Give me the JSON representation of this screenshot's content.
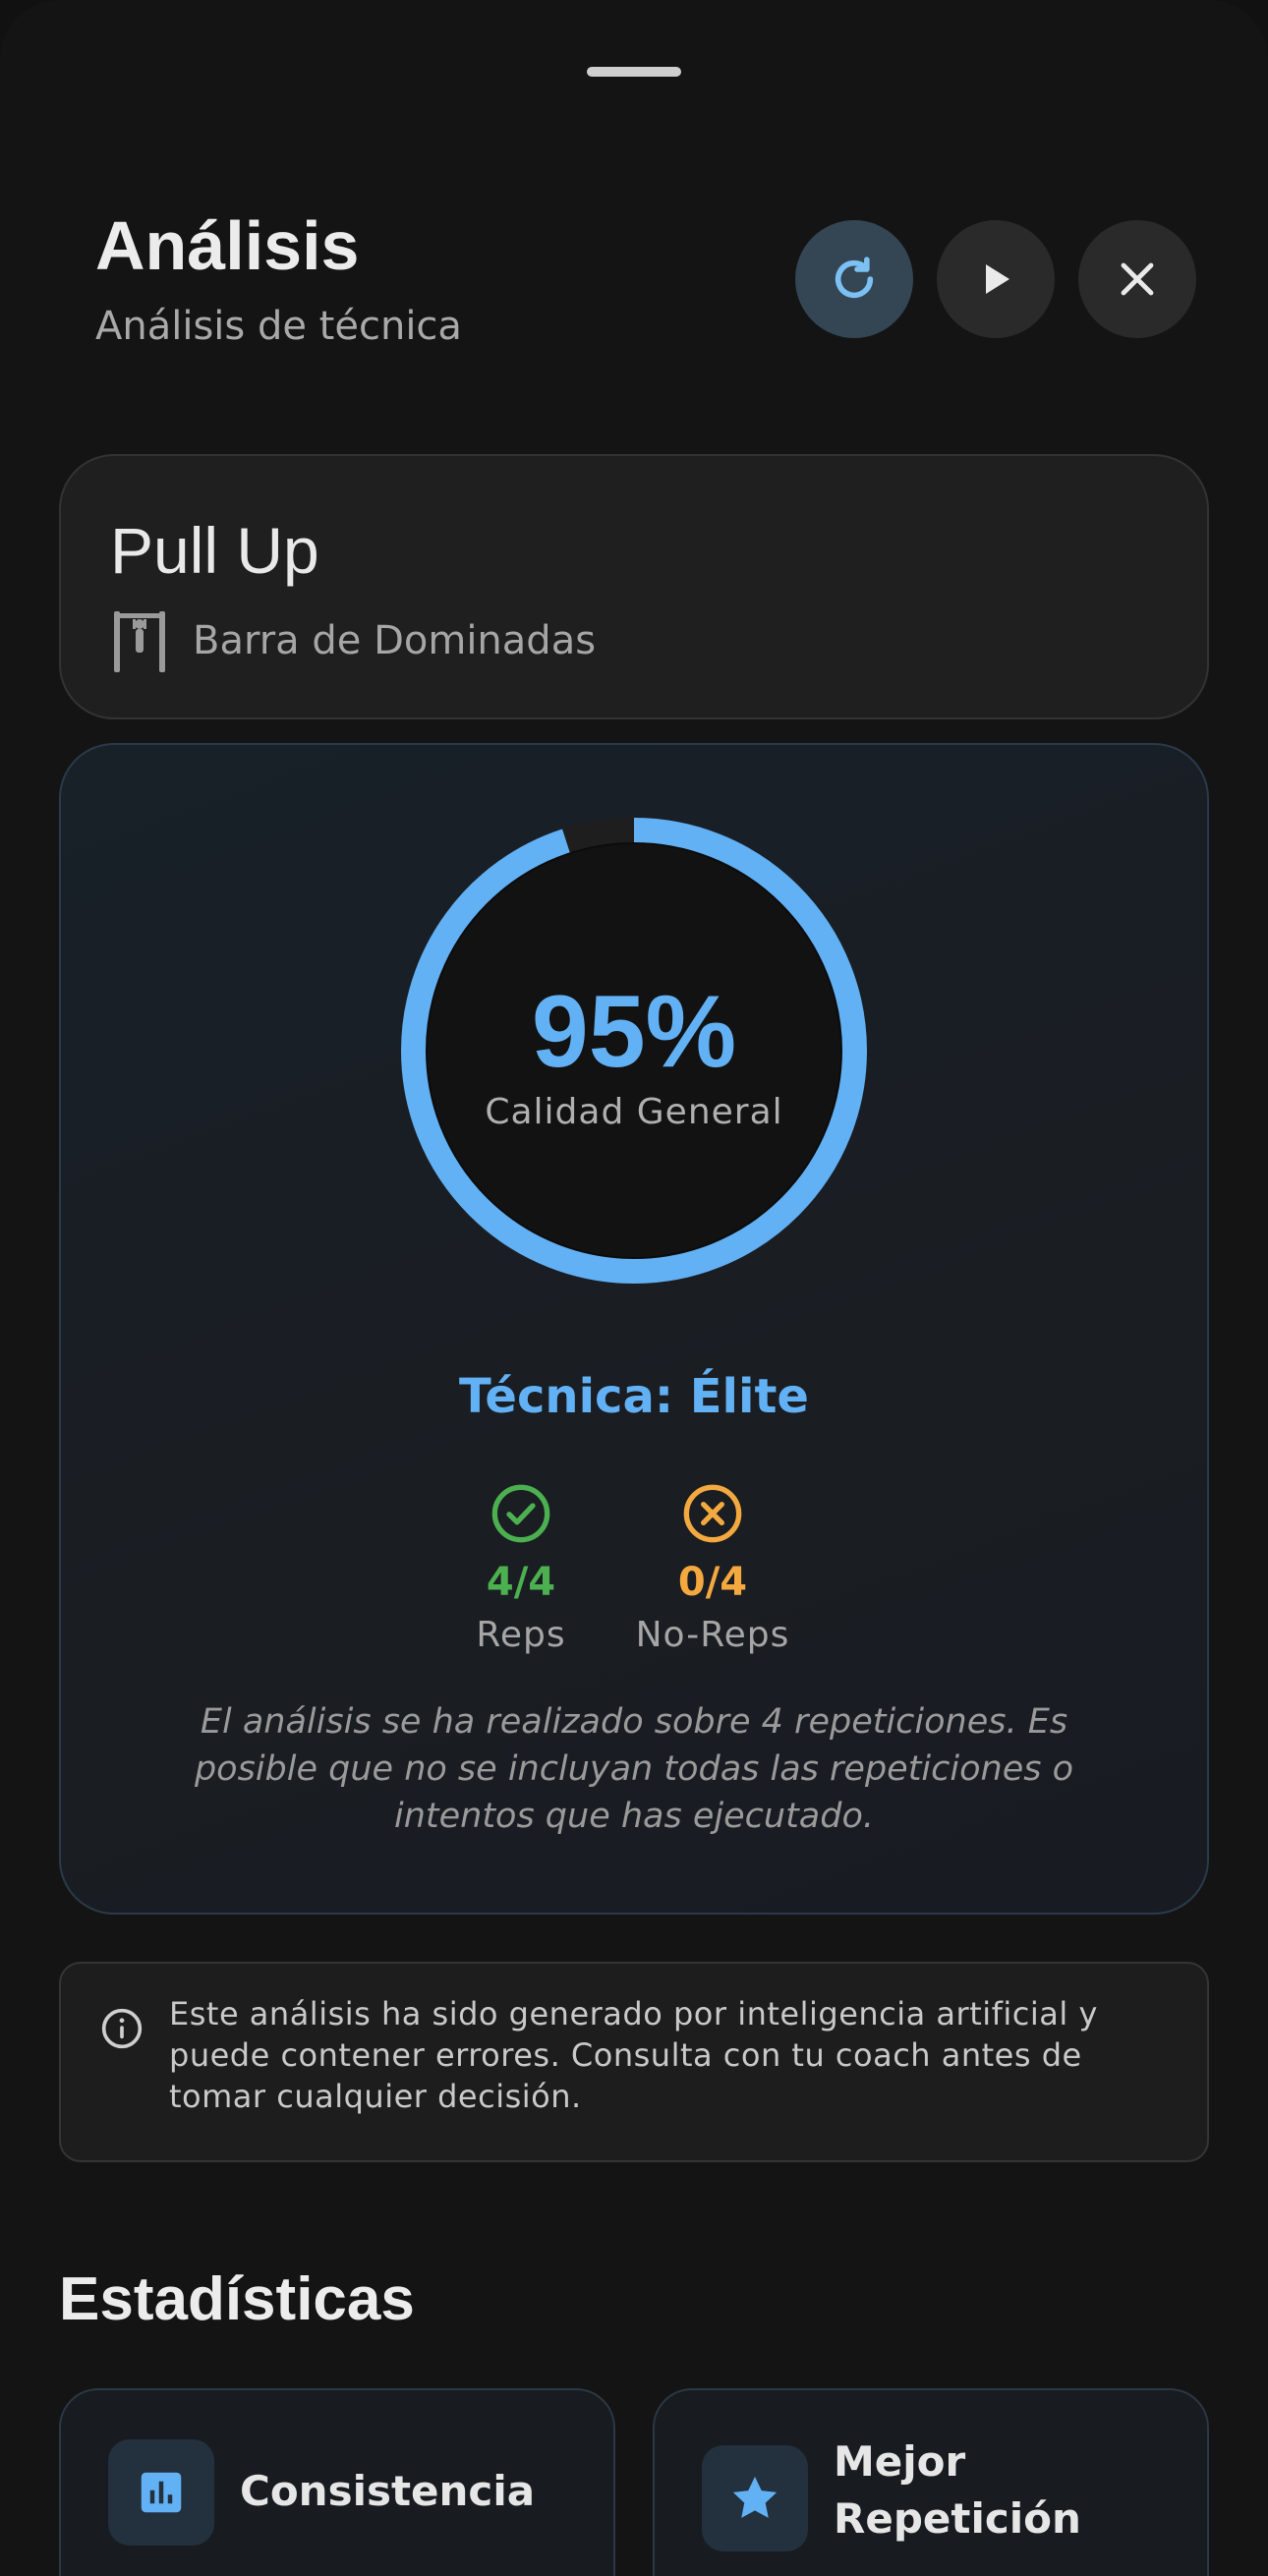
{
  "header": {
    "title": "Análisis",
    "subtitle": "Análisis de técnica"
  },
  "exercise": {
    "name": "Pull Up",
    "equipment": "Barra de Dominadas"
  },
  "score": {
    "percent_label": "95%",
    "percent_value": 95,
    "label": "Calidad General",
    "technique": "Técnica: Élite",
    "reps": {
      "value": "4/4",
      "label": "Reps"
    },
    "noreps": {
      "value": "0/4",
      "label": "No-Reps"
    },
    "note": "El análisis se ha realizado sobre 4 repeticiones. Es posible que no se incluyan todas las repeticiones o intentos que has ejecutado."
  },
  "disclaimer": {
    "text": "Este análisis ha sido generado por inteligencia artificial y puede contener errores. Consulta con tu coach antes de tomar cualquier decisión."
  },
  "stats": {
    "title": "Estadísticas",
    "cards": [
      {
        "label": "Consistencia",
        "icon": "bar-chart-icon"
      },
      {
        "label": "Mejor Repetición",
        "icon": "star-icon"
      }
    ]
  },
  "colors": {
    "accent": "#62b1f5",
    "success": "#4caf50",
    "warning": "#f4a940",
    "background": "#141414"
  }
}
